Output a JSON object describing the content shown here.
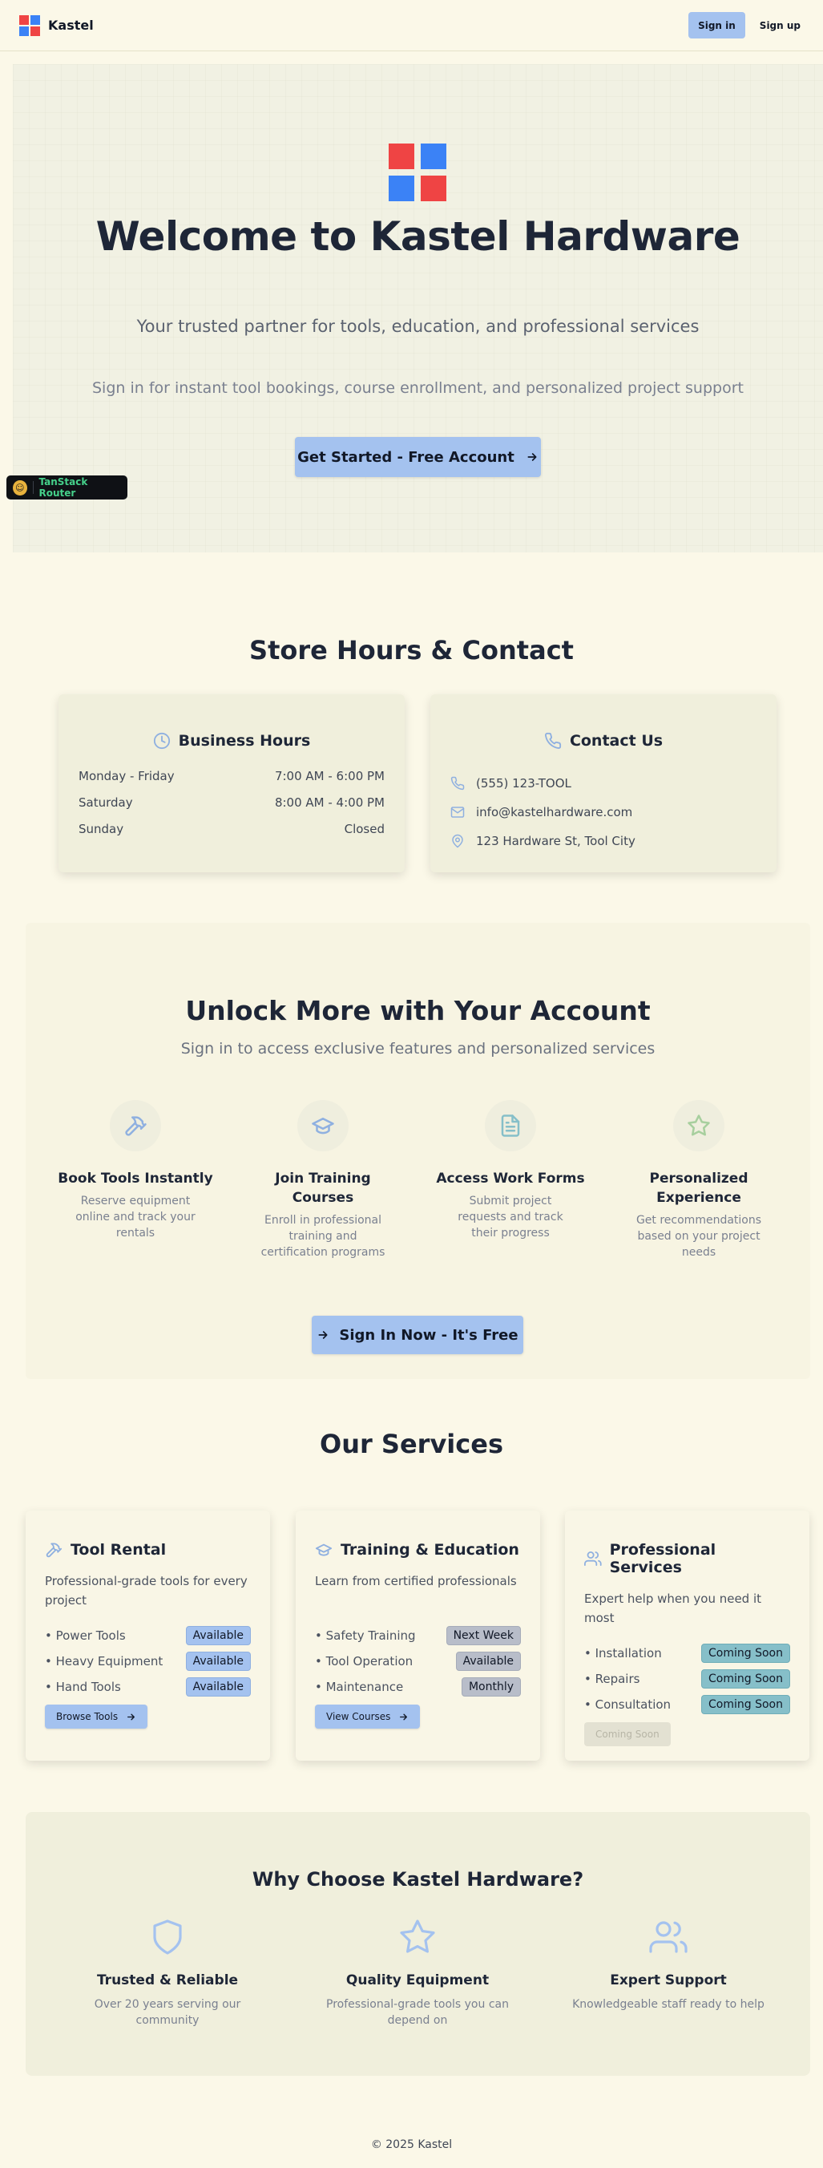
{
  "brand": {
    "name": "Kastel",
    "colors": {
      "red": "#ef4444",
      "blue": "#3b82f6",
      "accent": "#a4c2ef"
    }
  },
  "header": {
    "signin_label": "Sign in",
    "signup_label": "Sign up"
  },
  "hero": {
    "title": "Welcome to Kastel Hardware",
    "subtitle": "Your trusted partner for tools, education, and professional services",
    "subtitle2": "Sign in for instant tool bookings, course enrollment, and personalized project support",
    "cta_label": "Get Started - Free Account"
  },
  "devtools": {
    "label": "TanStack Router"
  },
  "store": {
    "title": "Store Hours & Contact",
    "hours": {
      "title": "Business Hours",
      "icon": "clock-icon",
      "rows": [
        {
          "day": "Monday - Friday",
          "time": "7:00 AM - 6:00 PM"
        },
        {
          "day": "Saturday",
          "time": "8:00 AM - 4:00 PM"
        },
        {
          "day": "Sunday",
          "time": "Closed"
        }
      ]
    },
    "contact": {
      "title": "Contact Us",
      "icon": "phone-icon",
      "phone": "(555) 123-TOOL",
      "email": "info@kastelhardware.com",
      "address": "123 Hardware St, Tool City"
    }
  },
  "unlock": {
    "title": "Unlock More with Your Account",
    "subtitle": "Sign in to access exclusive features and personalized services",
    "features": [
      {
        "icon": "hammer-icon",
        "title": "Book Tools Instantly",
        "desc": "Reserve equipment online and track your rentals"
      },
      {
        "icon": "graduation-cap-icon",
        "title": "Join Training Courses",
        "desc": "Enroll in professional training and certification programs"
      },
      {
        "icon": "document-icon",
        "title": "Access Work Forms",
        "desc": "Submit project requests and track their progress"
      },
      {
        "icon": "star-icon",
        "title": "Personalized Experience",
        "desc": "Get recommendations based on your project needs"
      }
    ],
    "cta_label": "Sign In Now - It's Free"
  },
  "services": {
    "title": "Our Services",
    "cards": [
      {
        "icon": "hammer-icon",
        "title": "Tool Rental",
        "desc": "Professional-grade tools for every project",
        "items": [
          {
            "label": "• Power Tools",
            "status": "Available"
          },
          {
            "label": "• Heavy Equipment",
            "status": "Available"
          },
          {
            "label": "• Hand Tools",
            "status": "Available"
          }
        ],
        "button": "Browse Tools"
      },
      {
        "icon": "graduation-cap-icon",
        "title": "Training & Education",
        "desc": "Learn from certified professionals",
        "items": [
          {
            "label": "• Safety Training",
            "status": "Next Week"
          },
          {
            "label": "• Tool Operation",
            "status": "Available"
          },
          {
            "label": "• Maintenance",
            "status": "Monthly"
          }
        ],
        "button": "View Courses"
      },
      {
        "icon": "users-icon",
        "title": "Professional Services",
        "desc": "Expert help when you need it most",
        "items": [
          {
            "label": "• Installation",
            "status": "Coming Soon"
          },
          {
            "label": "• Repairs",
            "status": "Coming Soon"
          },
          {
            "label": "• Consultation",
            "status": "Coming Soon"
          }
        ],
        "button": "Coming Soon"
      }
    ]
  },
  "why": {
    "title": "Why Choose Kastel Hardware?",
    "items": [
      {
        "icon": "shield-icon",
        "title": "Trusted & Reliable",
        "desc": "Over 20 years serving our community"
      },
      {
        "icon": "star-icon",
        "title": "Quality Equipment",
        "desc": "Professional-grade tools you can depend on"
      },
      {
        "icon": "users-icon",
        "title": "Expert Support",
        "desc": "Knowledgeable staff ready to help"
      }
    ]
  },
  "footer": {
    "copyright": "© 2025 Kastel"
  }
}
